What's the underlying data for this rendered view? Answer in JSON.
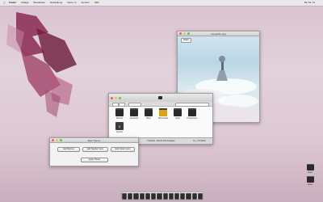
{
  "menubar": {
    "apple": "",
    "items": [
      "Finder",
      "Ablage",
      "Bearbeiten",
      "Darstellung",
      "Gehe zu",
      "Fenster",
      "Hilfe"
    ],
    "clock": "Mo 19. 11"
  },
  "image_window": {
    "title": "screenfile.png",
    "zoom_button": "Zoom"
  },
  "finder": {
    "title": "",
    "items": [
      {
        "label": "Monitor",
        "icon": "folder-monitor-icon"
      },
      {
        "label": "Netzwerk",
        "icon": "folder-network-icon"
      },
      {
        "label": "Filme",
        "icon": "folder-movies-icon"
      },
      {
        "label": "Downloads",
        "icon": "folder-downloads-icon"
      },
      {
        "label": "Apfel",
        "icon": "folder-apple-icon"
      },
      {
        "label": "Programme",
        "icon": "folder-applications-icon"
      },
      {
        "label": "System",
        "icon": "folder-system-icon"
      }
    ],
    "status": "7 Objekte, 195,93 GB verfügbar",
    "status_right": "sin_-3.0 Bilder"
  },
  "dialog": {
    "title": "Mac Theme",
    "buttons": [
      "Edit Buttons",
      "Edit Sidebar Icons",
      "Edit Folder Icons"
    ],
    "apply": "Apply Theme"
  },
  "desktop_icons": [
    {
      "label": "Icons",
      "icon": "drive-icon"
    },
    {
      "label": "Icons",
      "icon": "drive-icon"
    }
  ],
  "dock": {
    "count": 14
  },
  "colors": {
    "accent": "#e9dde3",
    "art": "#7a1f44"
  }
}
